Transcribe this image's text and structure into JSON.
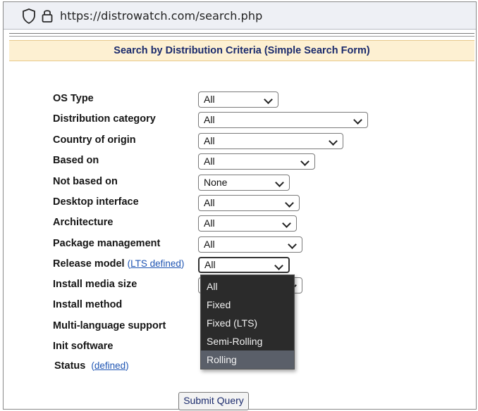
{
  "browser": {
    "url": "https://distrowatch.com/search.php"
  },
  "page": {
    "title": "Search by Distribution Criteria (Simple Search Form)",
    "submit_label": "Submit Query"
  },
  "form": {
    "os_type": {
      "label": "OS Type",
      "value": "All"
    },
    "distribution_category": {
      "label": "Distribution category",
      "value": "All"
    },
    "country_of_origin": {
      "label": "Country of origin",
      "value": "All"
    },
    "based_on": {
      "label": "Based on",
      "value": "All"
    },
    "not_based_on": {
      "label": "Not based on",
      "value": "None"
    },
    "desktop_interface": {
      "label": "Desktop interface",
      "value": "All"
    },
    "architecture": {
      "label": "Architecture",
      "value": "All"
    },
    "package_management": {
      "label": "Package management",
      "value": "All"
    },
    "release_model": {
      "label": "Release model",
      "link": "LTS defined",
      "value": "All"
    },
    "install_media_size": {
      "label": "Install media size"
    },
    "install_method": {
      "label": "Install method"
    },
    "multi_language_support": {
      "label": "Multi-language support"
    },
    "init_software": {
      "label": "Init software"
    },
    "status": {
      "label": "Status",
      "link": "defined"
    }
  },
  "release_model_dropdown": {
    "options": [
      "All",
      "Fixed",
      "Fixed (LTS)",
      "Semi-Rolling",
      "Rolling"
    ],
    "highlighted": "Rolling"
  },
  "icons": [
    "shield-icon",
    "lock-icon",
    "chevron-down-icon"
  ]
}
